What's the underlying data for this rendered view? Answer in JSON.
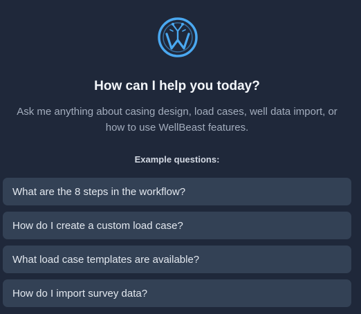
{
  "header": {
    "logo_icon": "wellbeast-logo-icon",
    "title": "How can I help you today?",
    "subtitle": "Ask me anything about casing design, load cases, well data import, or how to use WellBeast features."
  },
  "examples": {
    "label": "Example questions:",
    "questions": [
      "What are the 8 steps in the workflow?",
      "How do I create a custom load case?",
      "What load case templates are available?",
      "How do I import survey data?"
    ]
  },
  "colors": {
    "background": "#1f283a",
    "card": "#334155",
    "accent": "#4aa8f0"
  }
}
